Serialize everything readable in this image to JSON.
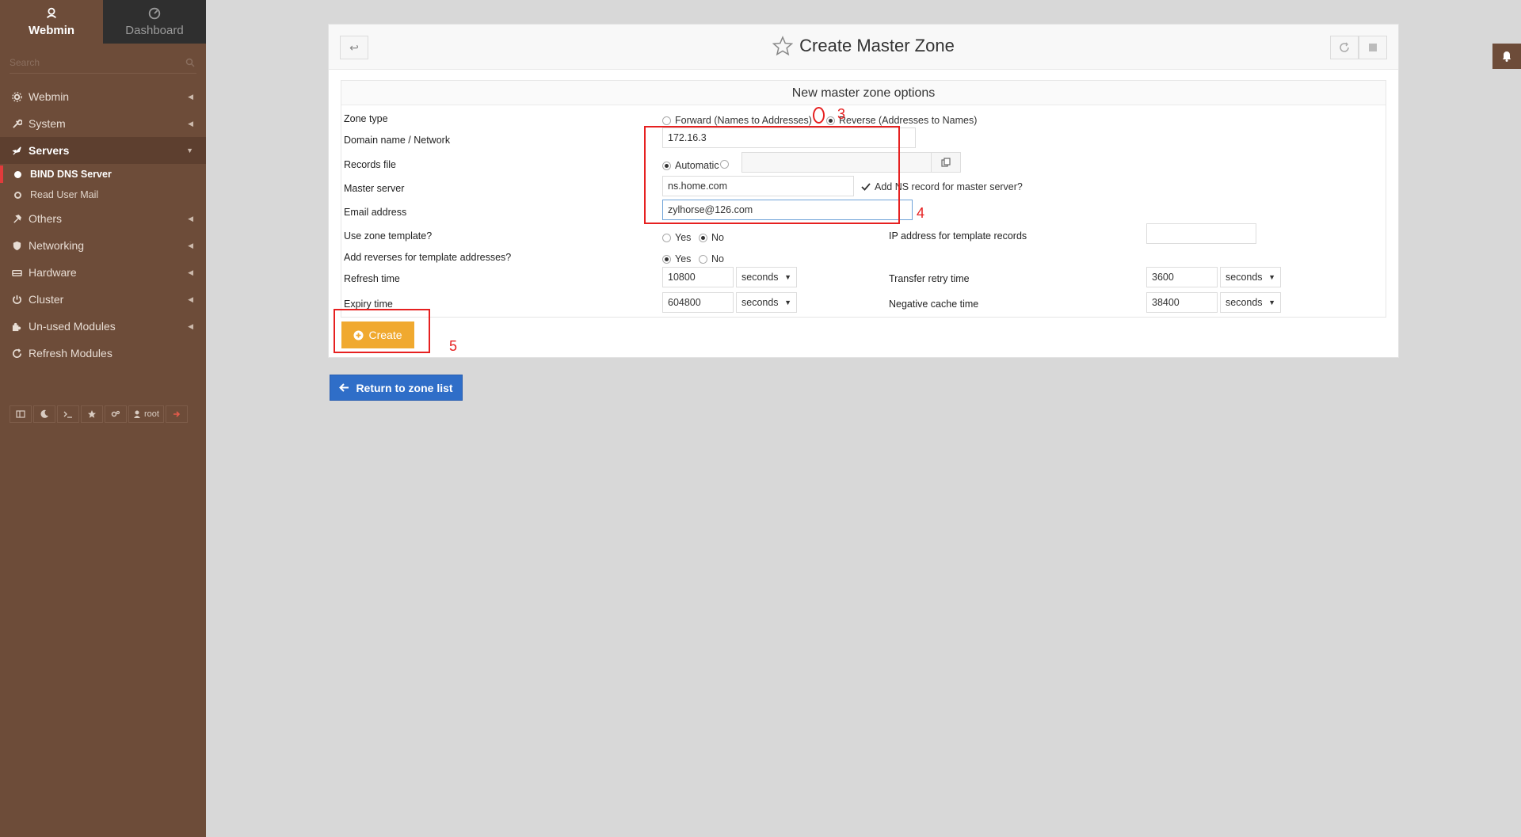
{
  "sidebar": {
    "tabs": [
      {
        "label": "Webmin",
        "icon": "webmin-logo-icon"
      },
      {
        "label": "Dashboard",
        "icon": "dashboard-icon"
      }
    ],
    "search_placeholder": "Search",
    "menu": [
      {
        "label": "Webmin",
        "icon": "gear-icon"
      },
      {
        "label": "System",
        "icon": "wrench-icon"
      },
      {
        "label": "Servers",
        "icon": "rocket-icon"
      },
      {
        "label": "Others",
        "icon": "hammer-icon"
      },
      {
        "label": "Networking",
        "icon": "shield-icon"
      },
      {
        "label": "Hardware",
        "icon": "hdd-icon"
      },
      {
        "label": "Cluster",
        "icon": "power-icon"
      },
      {
        "label": "Un-used Modules",
        "icon": "puzzle-icon"
      },
      {
        "label": "Refresh Modules",
        "icon": "refresh-icon"
      }
    ],
    "servers_sub": [
      {
        "label": "BIND DNS Server"
      },
      {
        "label": "Read User Mail"
      }
    ],
    "bottom_user": "root"
  },
  "page": {
    "title": "Create Master Zone"
  },
  "form": {
    "section_title": "New master zone options",
    "zone_type_label": "Zone type",
    "zone_type_forward": "Forward (Names to Addresses)",
    "zone_type_reverse": "Reverse (Addresses to Names)",
    "domain_label": "Domain name / Network",
    "domain_value": "172.16.3",
    "records_label": "Records file",
    "records_automatic": "Automatic",
    "master_label": "Master server",
    "master_value": "ns.home.com",
    "add_ns_label": "Add NS record for master server?",
    "email_label": "Email address",
    "email_value": "zylhorse@126.com",
    "template_label": "Use zone template?",
    "yes": "Yes",
    "no": "No",
    "ip_template_label": "IP address for template records",
    "add_reverses_label": "Add reverses for template addresses?",
    "refresh_label": "Refresh time",
    "refresh_value": "10800",
    "transfer_label": "Transfer retry time",
    "transfer_value": "3600",
    "expiry_label": "Expiry time",
    "expiry_value": "604800",
    "negative_label": "Negative cache time",
    "negative_value": "38400",
    "unit": "seconds",
    "create_label": "Create"
  },
  "return_label": "Return to zone list",
  "annotations": {
    "n3": "3",
    "n4": "4",
    "n5": "5"
  },
  "colors": {
    "sidebar_bg": "#6d4c39",
    "create_btn": "#f0a92f",
    "return_btn": "#2f6ec8",
    "annotation": "#e62020"
  }
}
